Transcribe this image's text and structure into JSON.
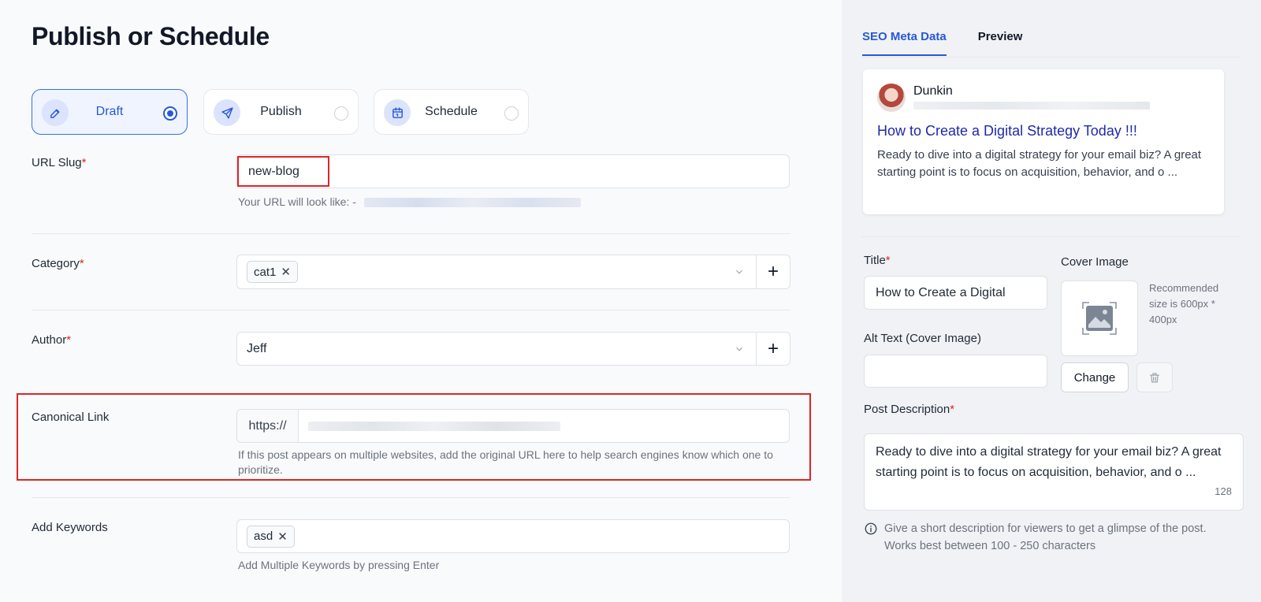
{
  "page": {
    "title": "Publish or Schedule"
  },
  "modes": [
    {
      "label": "Draft",
      "icon": "edit-icon",
      "selected": true
    },
    {
      "label": "Publish",
      "icon": "send-icon",
      "selected": false
    },
    {
      "label": "Schedule",
      "icon": "calendar-icon",
      "selected": false
    }
  ],
  "url_slug": {
    "label": "URL Slug",
    "required": "*",
    "value": "new-blog",
    "hint": "Your URL will look like: -"
  },
  "category": {
    "label": "Category",
    "required": "*",
    "tags": [
      "cat1"
    ],
    "remove_glyph": "✕",
    "add_glyph": "+"
  },
  "author": {
    "label": "Author",
    "required": "*",
    "value": "Jeff",
    "add_glyph": "+"
  },
  "canonical": {
    "label": "Canonical Link",
    "prefix": "https://",
    "hint": "If this post appears on multiple websites, add the original URL here to help search engines know which one to prioritize."
  },
  "keywords": {
    "label": "Add Keywords",
    "tags": [
      "asd"
    ],
    "remove_glyph": "✕",
    "hint": "Add Multiple Keywords by pressing Enter"
  },
  "right_tabs": [
    {
      "label": "SEO Meta Data",
      "active": true
    },
    {
      "label": "Preview",
      "active": false
    }
  ],
  "preview": {
    "author": "Dunkin",
    "title": "How to Create a Digital Strategy Today !!!",
    "description": "Ready to dive into a digital strategy for your email biz? A great starting point is to focus on acquisition, behavior, and o ..."
  },
  "seo": {
    "title_label": "Title",
    "title_required": "*",
    "title_value": "How to Create a Digital",
    "alt_label": "Alt Text (Cover Image)",
    "alt_value": "",
    "cover_label": "Cover Image",
    "cover_hint": "Recommended size is 600px * 400px",
    "change_label": "Change",
    "desc_label": "Post Description",
    "desc_required": "*",
    "desc_value": "Ready to dive into a digital strategy for your email biz? A great starting point is to focus on acquisition, behavior, and o ...",
    "desc_count": "128",
    "info_hint": "Give a short description for viewers to get a glimpse of the post. Works best between 100 - 250 characters"
  },
  "colors": {
    "accent": "#2758d6",
    "highlight": "#dc2626",
    "link_title": "#1e2aa8"
  }
}
